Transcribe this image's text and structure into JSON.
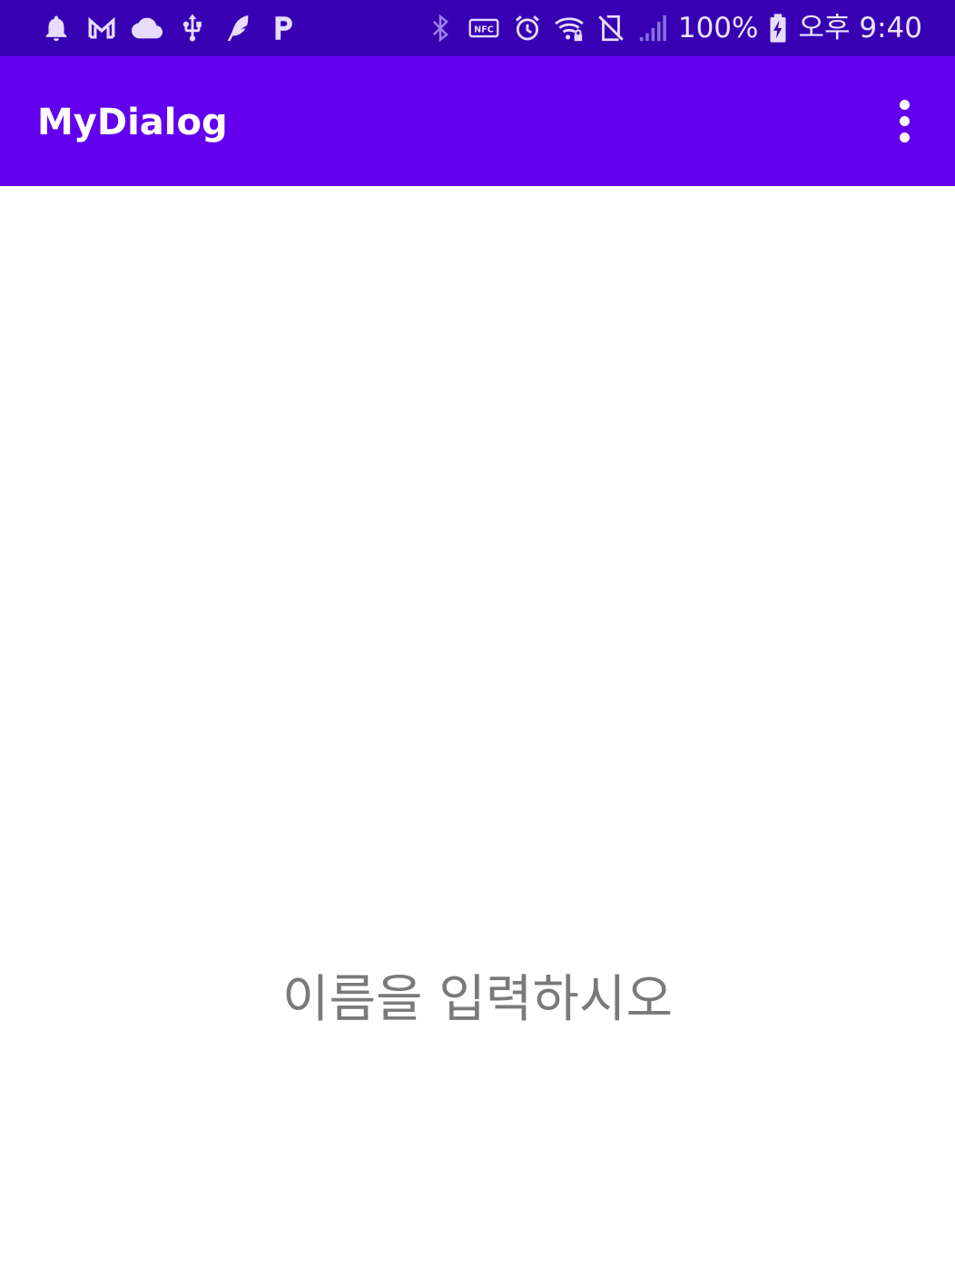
{
  "status_bar": {
    "left_icons": [
      "notification-bell-icon",
      "gmail-icon",
      "cloud-icon",
      "usb-icon",
      "app-feather-icon",
      "parking-p-icon"
    ],
    "right_icons": [
      "bluetooth-icon",
      "nfc-icon",
      "alarm-icon",
      "wifi-lock-icon",
      "no-sim-icon",
      "signal-icon"
    ],
    "nfc_label": "NFC",
    "battery_percent": "100%",
    "time": "오후 9:40"
  },
  "app_bar": {
    "title": "MyDialog",
    "overflow_icon": "more-vert-icon"
  },
  "main": {
    "prompt": "이름을 입력하시오"
  },
  "colors": {
    "status_bar": "#3700b3",
    "app_bar": "#6200ee",
    "prompt_text": "#7a7a7a",
    "background": "#ffffff"
  }
}
